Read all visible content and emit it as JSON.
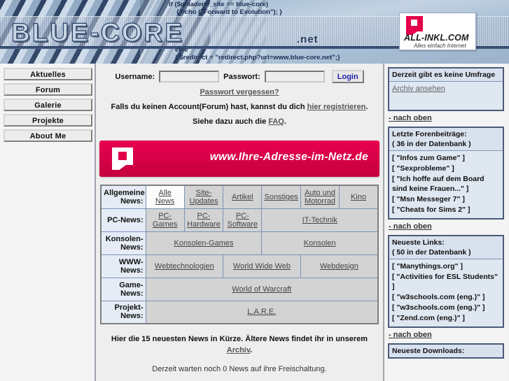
{
  "header": {
    "logo_text": "BLUE-CORE",
    "logo_suffix": ".net",
    "code_line_1": "if ($geladene_site == blue-core)",
    "code_line_2": "{ echo (\"Forward to Evolution\"); }",
    "code_line_3": "else",
    "code_line_4": "{ $redirect = \"redirect.php?url=www.blue-core.net\";}",
    "sponsor": {
      "name": "ALL-INKL.COM",
      "tagline": "Alles einfach Internet"
    }
  },
  "sidebar_left": {
    "items": [
      {
        "label": "Aktuelles"
      },
      {
        "label": "Forum"
      },
      {
        "label": "Galerie"
      },
      {
        "label": "Projekte"
      },
      {
        "label": "About Me"
      }
    ]
  },
  "login": {
    "username_label": "Username:",
    "username_value": "",
    "username_placeholder": "",
    "password_label": "Passwort:",
    "password_value": "",
    "password_placeholder": "",
    "button_label": "Login",
    "forgot_link": "Passwort vergessen?",
    "register_prefix": "Falls du keinen Account(Forum) hast, kannst du dich ",
    "register_link": "hier registrieren",
    "register_suffix": ".",
    "faq_prefix": "Siehe dazu auch die ",
    "faq_link": "FAQ",
    "faq_suffix": "."
  },
  "banner": {
    "text": "www.Ihre-Adresse-im-Netz.de"
  },
  "news_nav": {
    "rows": [
      {
        "label": "Allgemeine News:",
        "cells": [
          {
            "text": "Alle News",
            "active": true,
            "colspan": 1
          },
          {
            "text": "Site-Updates",
            "active": false,
            "colspan": 1
          },
          {
            "text": "Artikel",
            "active": false,
            "colspan": 1
          },
          {
            "text": "Sonstiges",
            "active": false,
            "colspan": 1
          },
          {
            "text": "Auto und Motorrad",
            "active": false,
            "colspan": 1
          },
          {
            "text": "Kino",
            "active": false,
            "colspan": 1
          }
        ]
      },
      {
        "label": "PC-News:",
        "cells": [
          {
            "text": "PC-Games",
            "active": false,
            "colspan": 1
          },
          {
            "text": "PC-Hardware",
            "active": false,
            "colspan": 1
          },
          {
            "text": "PC-Software",
            "active": false,
            "colspan": 1
          },
          {
            "text": "IT-Technik",
            "active": false,
            "colspan": 3
          }
        ]
      },
      {
        "label": "Konsolen-News:",
        "cells": [
          {
            "text": "Konsolen-Games",
            "active": false,
            "colspan": 3
          },
          {
            "text": "Konsolen",
            "active": false,
            "colspan": 3
          }
        ]
      },
      {
        "label": "WWW-News:",
        "cells": [
          {
            "text": "Webtechnologien",
            "active": false,
            "colspan": 2
          },
          {
            "text": "World Wide Web",
            "active": false,
            "colspan": 2
          },
          {
            "text": "Webdesign",
            "active": false,
            "colspan": 2
          }
        ]
      },
      {
        "label": "Game-News:",
        "cells": [
          {
            "text": "World of Warcraft",
            "active": false,
            "colspan": 6
          }
        ]
      },
      {
        "label": "Projekt-News:",
        "cells": [
          {
            "text": "L.A.R.E.",
            "active": false,
            "colspan": 6
          }
        ]
      }
    ]
  },
  "main_notes": {
    "archive_prefix": "Hier die 15 neuesten News in Kürze. Ältere News findet ihr in unserem ",
    "archive_link": "Archiv",
    "archive_suffix": ".",
    "pending": "Derzeit warten noch 0 News auf ihre Freischaltung."
  },
  "sidebar_right": {
    "back_to_top": "- nach oben",
    "poll": {
      "title": "Derzeit gibt es keine Umfrage",
      "archive_link": "Archiv ansehen"
    },
    "forum": {
      "title": "Letzte Forenbeiträge:",
      "count": "( 36 in der Datenbank )",
      "entries": [
        "[ \"Infos zum Game\" ]",
        "[ \"Sexprobleme\" ]",
        "[ \"Ich hoffe auf dem Board sind keine Frauen...\" ]",
        "[ \"Msn Messeger 7\" ]",
        "[ \"Cheats for Sims 2\" ]"
      ]
    },
    "links": {
      "title": "Neueste Links:",
      "count": "( 50 in der Datenbank )",
      "entries": [
        "[ \"Manythings.org\" ]",
        "[ \"Activities for ESL Students\" ]",
        "[ \"w3schools.com (eng.)\" ]",
        "[ \"w3schools.com (eng.)\" ]",
        "[ \"Zend.com (eng.)\" ]"
      ]
    },
    "downloads": {
      "title": "Neueste Downloads:"
    }
  },
  "colors": {
    "accent_red": "#e0004a",
    "header_blue": "#1f3457",
    "link_gray": "#555555",
    "login_blue": "#2222aa"
  }
}
